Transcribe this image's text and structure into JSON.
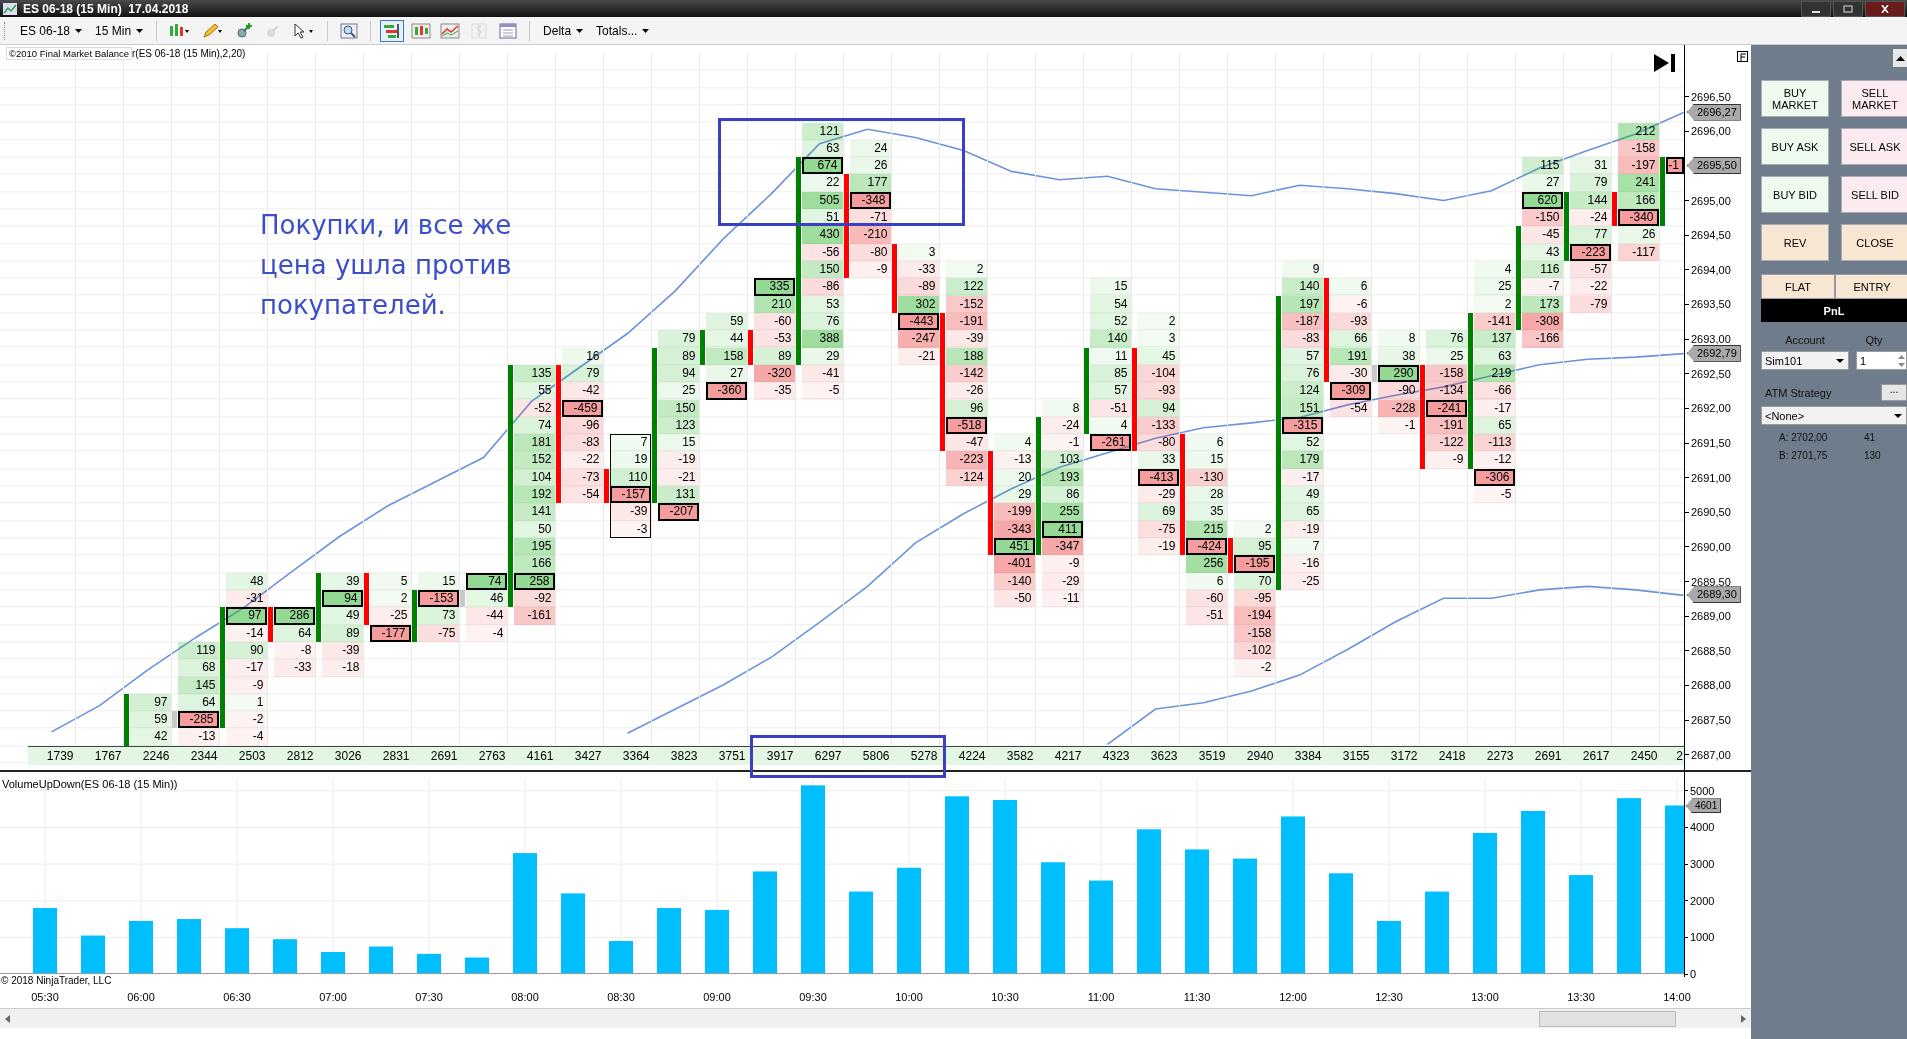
{
  "window": {
    "title": "ES 06-18 (15 Min)  17.04.2018"
  },
  "toolbar": {
    "instrument": "ES 06-18",
    "interval": "15 Min",
    "tools": [
      {
        "selected": false,
        "disabled": false
      },
      {
        "selected": false,
        "disabled": false
      },
      {
        "selected": false,
        "disabled": false
      },
      {
        "selected": false,
        "disabled": true
      },
      {
        "selected": false,
        "disabled": false
      },
      {
        "selected": false,
        "disabled": false
      },
      {
        "selected": true,
        "disabled": false
      },
      {
        "selected": false,
        "disabled": false
      },
      {
        "selected": false,
        "disabled": false
      },
      {
        "selected": false,
        "disabled": true
      },
      {
        "selected": false,
        "disabled": false
      }
    ],
    "delta": "Delta",
    "totals": "Totals..."
  },
  "footprint": {
    "indicator_label": "©2010 Final Market Balance",
    "indicator_params": "r(ES 06-18 (15 Min),2,20)",
    "bars": [
      {
        "total": "1739",
        "outlined": false
      },
      {
        "total": "1767",
        "outlined": false
      },
      {
        "total": "2246",
        "outlined": false,
        "kind": "up",
        "cells": [
          {
            "v": "97",
            "poc": false
          },
          {
            "v": "59",
            "poc": false
          },
          {
            "v": "42",
            "poc": false
          }
        ]
      },
      {
        "total": "2344",
        "outlined": false,
        "kind": "flat",
        "cells": [
          {
            "v": "119",
            "poc": false
          },
          {
            "v": "68",
            "poc": false
          },
          {
            "v": "145",
            "poc": false
          },
          {
            "v": "64",
            "poc": false
          },
          {
            "v": "-285",
            "poc": true
          },
          {
            "v": "-13",
            "poc": false
          }
        ]
      },
      {
        "total": "2503",
        "outlined": false,
        "kind": "up",
        "cells": [
          {
            "v": "48",
            "poc": false
          },
          {
            "v": "-31",
            "poc": false
          },
          {
            "v": "97",
            "poc": true
          },
          {
            "v": "-14",
            "poc": false
          },
          {
            "v": "90",
            "poc": false
          },
          {
            "v": "-17",
            "poc": false
          },
          {
            "v": "-9",
            "poc": false
          },
          {
            "v": "1",
            "poc": false
          },
          {
            "v": "-2",
            "poc": false
          },
          {
            "v": "-4",
            "poc": false
          }
        ]
      },
      {
        "total": "2812",
        "outlined": false,
        "kind": "down",
        "cells": [
          {
            "v": "286",
            "poc": true
          },
          {
            "v": "64",
            "poc": false
          },
          {
            "v": "-8",
            "poc": false
          },
          {
            "v": "-33",
            "poc": false
          }
        ]
      },
      {
        "total": "3026",
        "outlined": false,
        "kind": "up",
        "cells": [
          {
            "v": "39",
            "poc": false
          },
          {
            "v": "94",
            "poc": true
          },
          {
            "v": "49",
            "poc": false
          },
          {
            "v": "89",
            "poc": false
          },
          {
            "v": "-39",
            "poc": false
          },
          {
            "v": "-18",
            "poc": false
          }
        ]
      },
      {
        "total": "2831",
        "outlined": false,
        "kind": "down",
        "cells": [
          {
            "v": "5",
            "poc": false
          },
          {
            "v": "2",
            "poc": false
          },
          {
            "v": "-25",
            "poc": false
          },
          {
            "v": "-177",
            "poc": true
          }
        ]
      },
      {
        "total": "2691",
        "outlined": false,
        "kind": "up",
        "cells": [
          {
            "v": "15",
            "poc": false
          },
          {
            "v": "-153",
            "poc": true
          },
          {
            "v": "73",
            "poc": false
          },
          {
            "v": "-75",
            "poc": false
          }
        ]
      },
      {
        "total": "2763",
        "outlined": false,
        "kind": "flat",
        "cells": [
          {
            "v": "74",
            "poc": true
          },
          {
            "v": "46",
            "poc": false
          },
          {
            "v": "-44",
            "poc": false
          },
          {
            "v": "-4",
            "poc": false
          }
        ]
      },
      {
        "total": "4161",
        "outlined": false,
        "kind": "up",
        "cells": [
          {
            "v": "135",
            "poc": false
          },
          {
            "v": "55",
            "poc": false
          },
          {
            "v": "-52",
            "poc": false
          },
          {
            "v": "74",
            "poc": false
          },
          {
            "v": "181",
            "poc": false
          },
          {
            "v": "152",
            "poc": false
          },
          {
            "v": "104",
            "poc": false
          },
          {
            "v": "192",
            "poc": false
          },
          {
            "v": "141",
            "poc": false
          },
          {
            "v": "50",
            "poc": false
          },
          {
            "v": "195",
            "poc": false
          },
          {
            "v": "166",
            "poc": false
          },
          {
            "v": "258",
            "poc": true
          },
          {
            "v": "-92",
            "poc": false
          },
          {
            "v": "-161",
            "poc": false
          }
        ]
      },
      {
        "total": "3427",
        "outlined": false,
        "kind": "down",
        "cells": [
          {
            "v": "16",
            "poc": false
          },
          {
            "v": "79",
            "poc": false
          },
          {
            "v": "-42",
            "poc": false
          },
          {
            "v": "-459",
            "poc": true
          },
          {
            "v": "-96",
            "poc": false
          },
          {
            "v": "-83",
            "poc": false
          },
          {
            "v": "-22",
            "poc": false
          },
          {
            "v": "-73",
            "poc": false
          },
          {
            "v": "-54",
            "poc": false
          }
        ]
      },
      {
        "total": "3364",
        "outlined": true,
        "kind": "down",
        "cells": [
          {
            "v": "7",
            "poc": false
          },
          {
            "v": "19",
            "poc": false
          },
          {
            "v": "110",
            "poc": false
          },
          {
            "v": "-157",
            "poc": true
          },
          {
            "v": "-39",
            "poc": false
          },
          {
            "v": "-3",
            "poc": false
          }
        ]
      },
      {
        "total": "3823",
        "outlined": false,
        "kind": "up",
        "cells": [
          {
            "v": "79",
            "poc": false
          },
          {
            "v": "89",
            "poc": false
          },
          {
            "v": "94",
            "poc": false
          },
          {
            "v": "25",
            "poc": false
          },
          {
            "v": "150",
            "poc": false
          },
          {
            "v": "123",
            "poc": false
          },
          {
            "v": "15",
            "poc": false
          },
          {
            "v": "-19",
            "poc": false
          },
          {
            "v": "-21",
            "poc": false
          },
          {
            "v": "131",
            "poc": false
          },
          {
            "v": "-207",
            "poc": true
          }
        ]
      },
      {
        "total": "3751",
        "outlined": false,
        "kind": "up",
        "cells": [
          {
            "v": "59",
            "poc": false
          },
          {
            "v": "44",
            "poc": false
          },
          {
            "v": "158",
            "poc": false
          },
          {
            "v": "27",
            "poc": false
          },
          {
            "v": "-360",
            "poc": true
          }
        ]
      },
      {
        "total": "3917",
        "outlined": false,
        "kind": "down",
        "cells": [
          {
            "v": "335",
            "poc": true
          },
          {
            "v": "210",
            "poc": false
          },
          {
            "v": "-60",
            "poc": false
          },
          {
            "v": "-53",
            "poc": false
          },
          {
            "v": "89",
            "poc": false
          },
          {
            "v": "-320",
            "poc": false
          },
          {
            "v": "-35",
            "poc": false
          }
        ]
      },
      {
        "total": "6297",
        "outlined": false,
        "kind": "up",
        "cells": [
          {
            "v": "121",
            "poc": false
          },
          {
            "v": "63",
            "poc": false
          },
          {
            "v": "674",
            "poc": true
          },
          {
            "v": "22",
            "poc": false
          },
          {
            "v": "505",
            "poc": false
          },
          {
            "v": "51",
            "poc": false
          },
          {
            "v": "430",
            "poc": false
          },
          {
            "v": "-56",
            "poc": false
          },
          {
            "v": "150",
            "poc": false
          },
          {
            "v": "-86",
            "poc": false
          },
          {
            "v": "53",
            "poc": false
          },
          {
            "v": "76",
            "poc": false
          },
          {
            "v": "388",
            "poc": false
          },
          {
            "v": "29",
            "poc": false
          },
          {
            "v": "-41",
            "poc": false
          },
          {
            "v": "-5",
            "poc": false
          }
        ]
      },
      {
        "total": "5806",
        "outlined": false,
        "kind": "down",
        "cells": [
          {
            "v": "24",
            "poc": false
          },
          {
            "v": "26",
            "poc": false
          },
          {
            "v": "177",
            "poc": false
          },
          {
            "v": "-348",
            "poc": true
          },
          {
            "v": "-71",
            "poc": false
          },
          {
            "v": "-210",
            "poc": false
          },
          {
            "v": "-80",
            "poc": false
          },
          {
            "v": "-9",
            "poc": false
          }
        ]
      },
      {
        "total": "5278",
        "outlined": false,
        "kind": "down",
        "cells": [
          {
            "v": "3",
            "poc": false
          },
          {
            "v": "-33",
            "poc": false
          },
          {
            "v": "-89",
            "poc": false
          },
          {
            "v": "302",
            "poc": false
          },
          {
            "v": "-443",
            "poc": true
          },
          {
            "v": "-247",
            "poc": false
          },
          {
            "v": "-21",
            "poc": false
          }
        ]
      },
      {
        "total": "4224",
        "outlined": false,
        "kind": "down",
        "cells": [
          {
            "v": "2",
            "poc": false
          },
          {
            "v": "122",
            "poc": false
          },
          {
            "v": "-152",
            "poc": false
          },
          {
            "v": "-191",
            "poc": false
          },
          {
            "v": "-39",
            "poc": false
          },
          {
            "v": "188",
            "poc": false
          },
          {
            "v": "-142",
            "poc": false
          },
          {
            "v": "-26",
            "poc": false
          },
          {
            "v": "96",
            "poc": false
          },
          {
            "v": "-518",
            "poc": true
          },
          {
            "v": "-47",
            "poc": false
          },
          {
            "v": "-223",
            "poc": false
          },
          {
            "v": "-124",
            "poc": false
          }
        ]
      },
      {
        "total": "3582",
        "outlined": false,
        "kind": "down",
        "cells": [
          {
            "v": "4",
            "poc": false
          },
          {
            "v": "-13",
            "poc": false
          },
          {
            "v": "20",
            "poc": false
          },
          {
            "v": "29",
            "poc": false
          },
          {
            "v": "-199",
            "poc": false
          },
          {
            "v": "-343",
            "poc": false
          },
          {
            "v": "451",
            "poc": true
          },
          {
            "v": "-401",
            "poc": false
          },
          {
            "v": "-140",
            "poc": false
          },
          {
            "v": "-50",
            "poc": false
          }
        ]
      },
      {
        "total": "4217",
        "outlined": false,
        "kind": "up",
        "cells": [
          {
            "v": "8",
            "poc": false
          },
          {
            "v": "-24",
            "poc": false
          },
          {
            "v": "-1",
            "poc": false
          },
          {
            "v": "103",
            "poc": false
          },
          {
            "v": "193",
            "poc": false
          },
          {
            "v": "86",
            "poc": false
          },
          {
            "v": "255",
            "poc": false
          },
          {
            "v": "411",
            "poc": true
          },
          {
            "v": "-347",
            "poc": false
          },
          {
            "v": "-9",
            "poc": false
          },
          {
            "v": "-29",
            "poc": false
          },
          {
            "v": "-11",
            "poc": false
          }
        ]
      },
      {
        "total": "4323",
        "outlined": false,
        "kind": "up",
        "cells": [
          {
            "v": "15",
            "poc": false
          },
          {
            "v": "54",
            "poc": false
          },
          {
            "v": "52",
            "poc": false
          },
          {
            "v": "140",
            "poc": false
          },
          {
            "v": "11",
            "poc": false
          },
          {
            "v": "85",
            "poc": false
          },
          {
            "v": "57",
            "poc": false
          },
          {
            "v": "-51",
            "poc": false
          },
          {
            "v": "4",
            "poc": false
          },
          {
            "v": "-261",
            "poc": true
          }
        ]
      },
      {
        "total": "3623",
        "outlined": false,
        "kind": "down",
        "cells": [
          {
            "v": "2",
            "poc": false
          },
          {
            "v": "3",
            "poc": false
          },
          {
            "v": "45",
            "poc": false
          },
          {
            "v": "-104",
            "poc": false
          },
          {
            "v": "-93",
            "poc": false
          },
          {
            "v": "94",
            "poc": false
          },
          {
            "v": "-133",
            "poc": false
          },
          {
            "v": "-80",
            "poc": false
          },
          {
            "v": "33",
            "poc": false
          },
          {
            "v": "-413",
            "poc": true
          },
          {
            "v": "-29",
            "poc": false
          },
          {
            "v": "69",
            "poc": false
          },
          {
            "v": "-75",
            "poc": false
          },
          {
            "v": "-19",
            "poc": false
          }
        ]
      },
      {
        "total": "3519",
        "outlined": false,
        "kind": "down",
        "cells": [
          {
            "v": "6",
            "poc": false
          },
          {
            "v": "15",
            "poc": false
          },
          {
            "v": "-130",
            "poc": false
          },
          {
            "v": "28",
            "poc": false
          },
          {
            "v": "35",
            "poc": false
          },
          {
            "v": "215",
            "poc": false
          },
          {
            "v": "-424",
            "poc": true
          },
          {
            "v": "256",
            "poc": false
          },
          {
            "v": "6",
            "poc": false
          },
          {
            "v": "-60",
            "poc": false
          },
          {
            "v": "-51",
            "poc": false
          }
        ]
      },
      {
        "total": "2940",
        "outlined": false,
        "kind": "down",
        "cells": [
          {
            "v": "2",
            "poc": false
          },
          {
            "v": "95",
            "poc": false
          },
          {
            "v": "-195",
            "poc": true
          },
          {
            "v": "70",
            "poc": false
          },
          {
            "v": "-95",
            "poc": false
          },
          {
            "v": "-194",
            "poc": false
          },
          {
            "v": "-158",
            "poc": false
          },
          {
            "v": "-102",
            "poc": false
          },
          {
            "v": "-2",
            "poc": false
          }
        ]
      },
      {
        "total": "3384",
        "outlined": false,
        "kind": "up",
        "cells": [
          {
            "v": "9",
            "poc": false
          },
          {
            "v": "140",
            "poc": false
          },
          {
            "v": "197",
            "poc": false
          },
          {
            "v": "-187",
            "poc": false
          },
          {
            "v": "-83",
            "poc": false
          },
          {
            "v": "57",
            "poc": false
          },
          {
            "v": "76",
            "poc": false
          },
          {
            "v": "124",
            "poc": false
          },
          {
            "v": "151",
            "poc": false
          },
          {
            "v": "-315",
            "poc": true
          },
          {
            "v": "52",
            "poc": false
          },
          {
            "v": "179",
            "poc": false
          },
          {
            "v": "-17",
            "poc": false
          },
          {
            "v": "49",
            "poc": false
          },
          {
            "v": "65",
            "poc": false
          },
          {
            "v": "-19",
            "poc": false
          },
          {
            "v": "7",
            "poc": false
          },
          {
            "v": "-16",
            "poc": false
          },
          {
            "v": "-25",
            "poc": false
          }
        ]
      },
      {
        "total": "3155",
        "outlined": false,
        "kind": "down",
        "cells": [
          {
            "v": "6",
            "poc": false
          },
          {
            "v": "-6",
            "poc": false
          },
          {
            "v": "-93",
            "poc": false
          },
          {
            "v": "66",
            "poc": false
          },
          {
            "v": "191",
            "poc": false
          },
          {
            "v": "-30",
            "poc": false
          },
          {
            "v": "-309",
            "poc": true
          },
          {
            "v": "-54",
            "poc": false
          }
        ]
      },
      {
        "total": "3172",
        "outlined": false,
        "kind": "flat",
        "cells": [
          {
            "v": "8",
            "poc": false
          },
          {
            "v": "38",
            "poc": false
          },
          {
            "v": "290",
            "poc": true
          },
          {
            "v": "-90",
            "poc": false
          },
          {
            "v": "-228",
            "poc": false
          },
          {
            "v": "-1",
            "poc": false
          }
        ]
      },
      {
        "total": "2418",
        "outlined": false,
        "kind": "down",
        "cells": [
          {
            "v": "76",
            "poc": false
          },
          {
            "v": "25",
            "poc": false
          },
          {
            "v": "-158",
            "poc": false
          },
          {
            "v": "-134",
            "poc": false
          },
          {
            "v": "-241",
            "poc": true
          },
          {
            "v": "-191",
            "poc": false
          },
          {
            "v": "-122",
            "poc": false
          },
          {
            "v": "-9",
            "poc": false
          }
        ]
      },
      {
        "total": "2273",
        "outlined": false,
        "kind": "up",
        "cells": [
          {
            "v": "4",
            "poc": false
          },
          {
            "v": "25",
            "poc": false
          },
          {
            "v": "2",
            "poc": false
          },
          {
            "v": "-141",
            "poc": false
          },
          {
            "v": "137",
            "poc": false
          },
          {
            "v": "63",
            "poc": false
          },
          {
            "v": "219",
            "poc": false
          },
          {
            "v": "-66",
            "poc": false
          },
          {
            "v": "-17",
            "poc": false
          },
          {
            "v": "65",
            "poc": false
          },
          {
            "v": "-113",
            "poc": false
          },
          {
            "v": "-12",
            "poc": false
          },
          {
            "v": "-306",
            "poc": true
          },
          {
            "v": "-5",
            "poc": false
          }
        ]
      },
      {
        "total": "2691",
        "outlined": false,
        "kind": "up",
        "cells": [
          {
            "v": "115",
            "poc": false
          },
          {
            "v": "27",
            "poc": false
          },
          {
            "v": "620",
            "poc": true
          },
          {
            "v": "-150",
            "poc": false
          },
          {
            "v": "-45",
            "poc": false
          },
          {
            "v": "43",
            "poc": false
          },
          {
            "v": "116",
            "poc": false
          },
          {
            "v": "-7",
            "poc": false
          },
          {
            "v": "173",
            "poc": false
          },
          {
            "v": "-308",
            "poc": false
          },
          {
            "v": "-166",
            "poc": false
          }
        ]
      },
      {
        "total": "2617",
        "outlined": false,
        "kind": "up",
        "cells": [
          {
            "v": "31",
            "poc": false
          },
          {
            "v": "79",
            "poc": false
          },
          {
            "v": "144",
            "poc": false
          },
          {
            "v": "-24",
            "poc": false
          },
          {
            "v": "77",
            "poc": false
          },
          {
            "v": "-223",
            "poc": true
          },
          {
            "v": "-57",
            "poc": false
          },
          {
            "v": "-22",
            "poc": false
          },
          {
            "v": "-79",
            "poc": false
          }
        ]
      },
      {
        "total": "2450",
        "outlined": false,
        "kind": "down",
        "cells": [
          {
            "v": "212",
            "poc": false
          },
          {
            "v": "-158",
            "poc": false
          },
          {
            "v": "-197",
            "poc": false
          },
          {
            "v": "241",
            "poc": false
          },
          {
            "v": "166",
            "poc": false
          },
          {
            "v": "-340",
            "poc": true
          },
          {
            "v": "26",
            "poc": false
          },
          {
            "v": "-117",
            "poc": false
          }
        ]
      },
      {
        "total": "2",
        "outlined": false,
        "kind": "up",
        "cells": [
          {
            "v": "-1",
            "poc": true
          }
        ]
      }
    ],
    "chart_data": {
      "type": "line",
      "ylim": [
        2686.875,
        2697.125
      ],
      "yticks": [
        {
          "value": 2696.5,
          "label": "2696,50"
        },
        {
          "value": 2696.0,
          "label": "2696,00"
        },
        {
          "value": 2695.0,
          "label": "2695,00"
        },
        {
          "value": 2694.5,
          "label": "2694,50"
        },
        {
          "value": 2694.0,
          "label": "2694,00"
        },
        {
          "value": 2693.5,
          "label": "2693,50"
        },
        {
          "value": 2693.0,
          "label": "2693,00"
        },
        {
          "value": 2692.5,
          "label": "2692,50"
        },
        {
          "value": 2692.0,
          "label": "2692,00"
        },
        {
          "value": 2691.5,
          "label": "2691,50"
        },
        {
          "value": 2691.0,
          "label": "2691,00"
        },
        {
          "value": 2690.5,
          "label": "2690,50"
        },
        {
          "value": 2690.0,
          "label": "2690,00"
        },
        {
          "value": 2689.5,
          "label": "2689,50"
        },
        {
          "value": 2689.0,
          "label": "2689,00"
        },
        {
          "value": 2688.5,
          "label": "2688,50"
        },
        {
          "value": 2688.0,
          "label": "2688,00"
        },
        {
          "value": 2687.5,
          "label": "2687,50"
        },
        {
          "value": 2687.0,
          "label": "2687,00"
        }
      ],
      "series": [
        {
          "color": "#6d93dc",
          "values": [
            2687.33,
            2687.71,
            2688.22,
            2688.69,
            2689.12,
            2689.64,
            2690.15,
            2690.59,
            2690.94,
            2691.29,
            2692.1,
            2692.59,
            2693.08,
            2693.7,
            2694.45,
            2695.1,
            2695.82,
            2696.03,
            2695.91,
            2695.72,
            2695.42,
            2695.3,
            2695.35,
            2695.17,
            2695.12,
            2695.07,
            2695.22,
            2695.17,
            2695.1,
            2695.0,
            2695.14,
            2695.47,
            2695.72,
            2695.96,
            2696.27
          ]
        },
        {
          "color": "#6d93dc",
          "values": [
            null,
            null,
            null,
            null,
            null,
            null,
            null,
            null,
            null,
            null,
            null,
            null,
            2687.31,
            2687.66,
            2688.01,
            2688.41,
            2688.91,
            2689.43,
            2690.06,
            2690.48,
            2690.84,
            2691.15,
            2691.36,
            2691.57,
            2691.72,
            2691.79,
            2691.87,
            2692.05,
            2692.19,
            2692.31,
            2692.47,
            2692.63,
            2692.71,
            2692.74,
            2692.79
          ]
        },
        {
          "color": "#6d93dc",
          "values": [
            null,
            null,
            null,
            null,
            null,
            null,
            null,
            null,
            null,
            null,
            null,
            null,
            null,
            null,
            null,
            null,
            null,
            null,
            null,
            null,
            null,
            null,
            2687.15,
            2687.66,
            2687.75,
            2687.92,
            2688.15,
            2688.52,
            2688.92,
            2689.26,
            2689.26,
            2689.38,
            2689.43,
            2689.38,
            2689.3
          ]
        }
      ]
    },
    "price_tags": [
      "2696,27",
      "2695,50",
      "2692,79",
      "2689,30"
    ]
  },
  "annotation": {
    "text": "Покупки, и все же\nцена ушла против\nпокупателей."
  },
  "volume": {
    "last_value_tag": "4601",
    "copyright": "© 2018 NinjaTrader, LLC",
    "chart_data": {
      "type": "bar",
      "title": "VolumeUpDown(ES 06-18 (15 Min))",
      "grid": true,
      "categories": [
        "05:30",
        null,
        "06:00",
        null,
        "06:30",
        null,
        "07:00",
        null,
        "07:30",
        null,
        "08:00",
        null,
        "08:30",
        null,
        "09:00",
        null,
        "09:30",
        null,
        "10:00",
        null,
        "10:30",
        null,
        "11:00",
        null,
        "11:30",
        null,
        "12:00",
        null,
        "12:30",
        null,
        "13:00",
        null,
        "13:30",
        null,
        "14:00"
      ],
      "values": [
        1800,
        1050,
        1450,
        1500,
        1250,
        950,
        600,
        750,
        550,
        450,
        3300,
        2200,
        900,
        1800,
        1750,
        2800,
        5150,
        2250,
        2900,
        4850,
        4750,
        3050,
        2550,
        3950,
        3400,
        3150,
        4300,
        2750,
        1450,
        2250,
        3850,
        4450,
        2700,
        4800,
        4600
      ],
      "ylim": [
        0,
        5350
      ],
      "yticks": [
        {
          "value": 0,
          "label": "0"
        },
        {
          "value": 1000,
          "label": "1000"
        },
        {
          "value": 2000,
          "label": "2000"
        },
        {
          "value": 3000,
          "label": "3000"
        },
        {
          "value": 4000,
          "label": "4000"
        },
        {
          "value": 5000,
          "label": "5000"
        }
      ]
    }
  },
  "order_panel": {
    "buttons": [
      {
        "label": "BUY\nMARKET",
        "kind": "buy"
      },
      {
        "label": "SELL\nMARKET",
        "kind": "sell"
      },
      {
        "label": "BUY ASK",
        "kind": "buy"
      },
      {
        "label": "SELL ASK",
        "kind": "sell"
      },
      {
        "label": "BUY BID",
        "kind": "buy"
      },
      {
        "label": "SELL BID",
        "kind": "sell"
      },
      {
        "label": "REV",
        "kind": "neutral"
      },
      {
        "label": "CLOSE",
        "kind": "neutral"
      }
    ],
    "position_tabs": [
      "FLAT",
      "ENTRY"
    ],
    "pnl": "PnL",
    "account_label": "Account",
    "qty_label": "Qty",
    "account": "Sim101",
    "qty": "1",
    "atm_label": "ATM Strategy",
    "atm_button": "...",
    "atm_strategy": "<None>",
    "quotes": [
      {
        "label": "A: 2702,00",
        "size": "41"
      },
      {
        "label": "B: 2701,75",
        "size": "130"
      }
    ]
  }
}
